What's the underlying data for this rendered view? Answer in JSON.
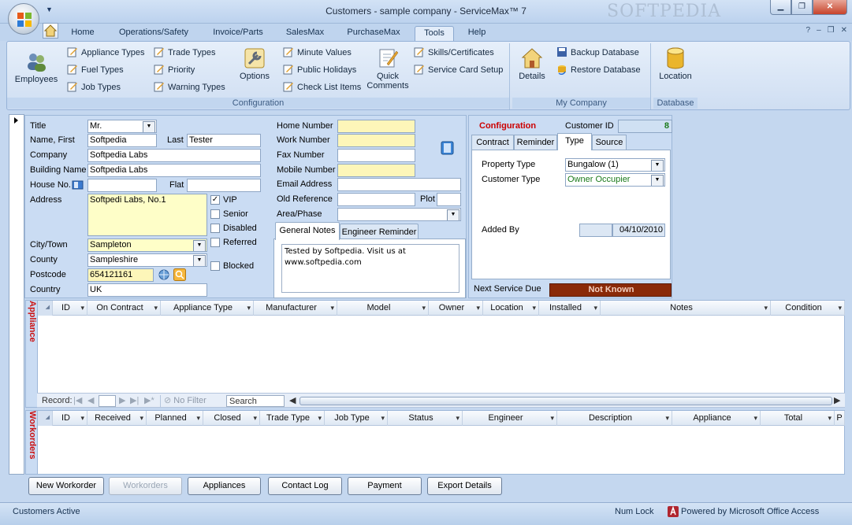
{
  "window": {
    "title": "Customers - sample company - ServiceMax™ 7",
    "watermark": "SOFTPEDIA",
    "minimize": "▁",
    "restore": "❐",
    "close": "✕"
  },
  "ribbon_tabs": [
    "Home",
    "Operations/Safety",
    "Invoice/Parts",
    "SalesMax",
    "PurchaseMax",
    "Tools",
    "Help"
  ],
  "ribbon_right": {
    "help": "?",
    "min": "–",
    "restore": "❐",
    "close": "✕"
  },
  "ribbon": {
    "configuration": {
      "label": "Configuration",
      "employees": "Employees",
      "appliance_types": "Appliance Types",
      "fuel_types": "Fuel Types",
      "job_types": "Job Types",
      "trade_types": "Trade Types",
      "priority": "Priority",
      "warning_types": "Warning Types",
      "options": "Options",
      "minute_values": "Minute Values",
      "public_holidays": "Public Holidays",
      "check_list_items": "Check List Items",
      "quick_comments_1": "Quick",
      "quick_comments_2": "Comments",
      "skills_certificates": "Skills/Certificates",
      "service_card_setup": "Service Card Setup"
    },
    "my_company": {
      "label": "My Company",
      "details": "Details",
      "backup_database": "Backup Database",
      "restore_database": "Restore Database"
    },
    "database": {
      "label": "Database",
      "location": "Location"
    }
  },
  "customer": {
    "labels": {
      "title": "Title",
      "name_first": "Name, First",
      "last": "Last",
      "company": "Company",
      "building_name": "Building Name",
      "house_no": "House No.",
      "flat": "Flat",
      "address": "Address",
      "city_town": "City/Town",
      "county": "County",
      "postcode": "Postcode",
      "country": "Country",
      "home_number": "Home Number",
      "work_number": "Work Number",
      "fax_number": "Fax Number",
      "mobile_number": "Mobile Number",
      "email_address": "Email Address",
      "old_reference": "Old Reference",
      "plot": "Plot",
      "area_phase": "Area/Phase"
    },
    "values": {
      "title": "Mr.",
      "first_name": "Softpedia",
      "last_name": "Tester",
      "company": "Softpedia Labs",
      "building_name": "Softpedia Labs",
      "house_no": "",
      "flat": "",
      "address": "Softpedi Labs, No.1",
      "city_town": "Sampleton",
      "county": "Sampleshire",
      "postcode": "654121161",
      "country": "UK",
      "home_number": "",
      "work_number": "",
      "fax_number": "",
      "mobile_number": "",
      "email_address": "",
      "old_reference": "",
      "plot": "",
      "area_phase": ""
    },
    "flags": {
      "vip": "VIP",
      "senior": "Senior",
      "disabled": "Disabled",
      "referred": "Referred",
      "blocked": "Blocked",
      "vip_checked": "✓"
    },
    "notes_tabs": [
      "General Notes",
      "Engineer Reminder"
    ],
    "general_notes_line1": "Tested by Softpedia. Visit us at",
    "general_notes_line2": "www.softpedia.com"
  },
  "configuration": {
    "heading": "Configuration",
    "customer_id_label": "Customer ID",
    "customer_id": "8",
    "tabs": [
      "Contract",
      "Reminder",
      "Type",
      "Source"
    ],
    "property_type_label": "Property Type",
    "property_type": "Bungalow (1)",
    "customer_type_label": "Customer Type",
    "customer_type": "Owner Occupier",
    "added_by_label": "Added By",
    "added_by": "",
    "added_date": "04/10/2010",
    "next_service_label": "Next Service Due",
    "next_service_value": "Not Known"
  },
  "appliance_grid": {
    "side_label": "Appliance",
    "columns": [
      "ID",
      "On Contract",
      "Appliance Type",
      "Manufacturer",
      "Model",
      "Owner",
      "Location",
      "Installed",
      "Notes",
      "Condition"
    ]
  },
  "record_nav": {
    "record_label": "Record:",
    "first": "|◀",
    "prev": "◀",
    "next": "▶",
    "last": "▶|",
    "new": "▶*",
    "no_filter": "No Filter",
    "search": "Search",
    "scroll_left": "◀",
    "scroll_right": "▶"
  },
  "workorder_grid": {
    "side_label": "Workorders",
    "columns": [
      "ID",
      "Received",
      "Planned",
      "Closed",
      "Trade Type",
      "Job Type",
      "Status",
      "Engineer",
      "Description",
      "Appliance",
      "Total",
      "P"
    ]
  },
  "actions": [
    "New Workorder",
    "Workorders",
    "Appliances",
    "Contact Log",
    "Payment",
    "Export Details"
  ],
  "status_bar": {
    "left": "Customers Active",
    "num_lock": "Num Lock",
    "powered_by": "Powered by Microsoft Office Access"
  },
  "colors": {
    "required_yellow": "#fefec8",
    "config_heading": "#cc0000",
    "customer_id_green": "#1a7a1a",
    "not_known_bg": "#8a2a08",
    "grid_side_label": "#cc1111"
  }
}
